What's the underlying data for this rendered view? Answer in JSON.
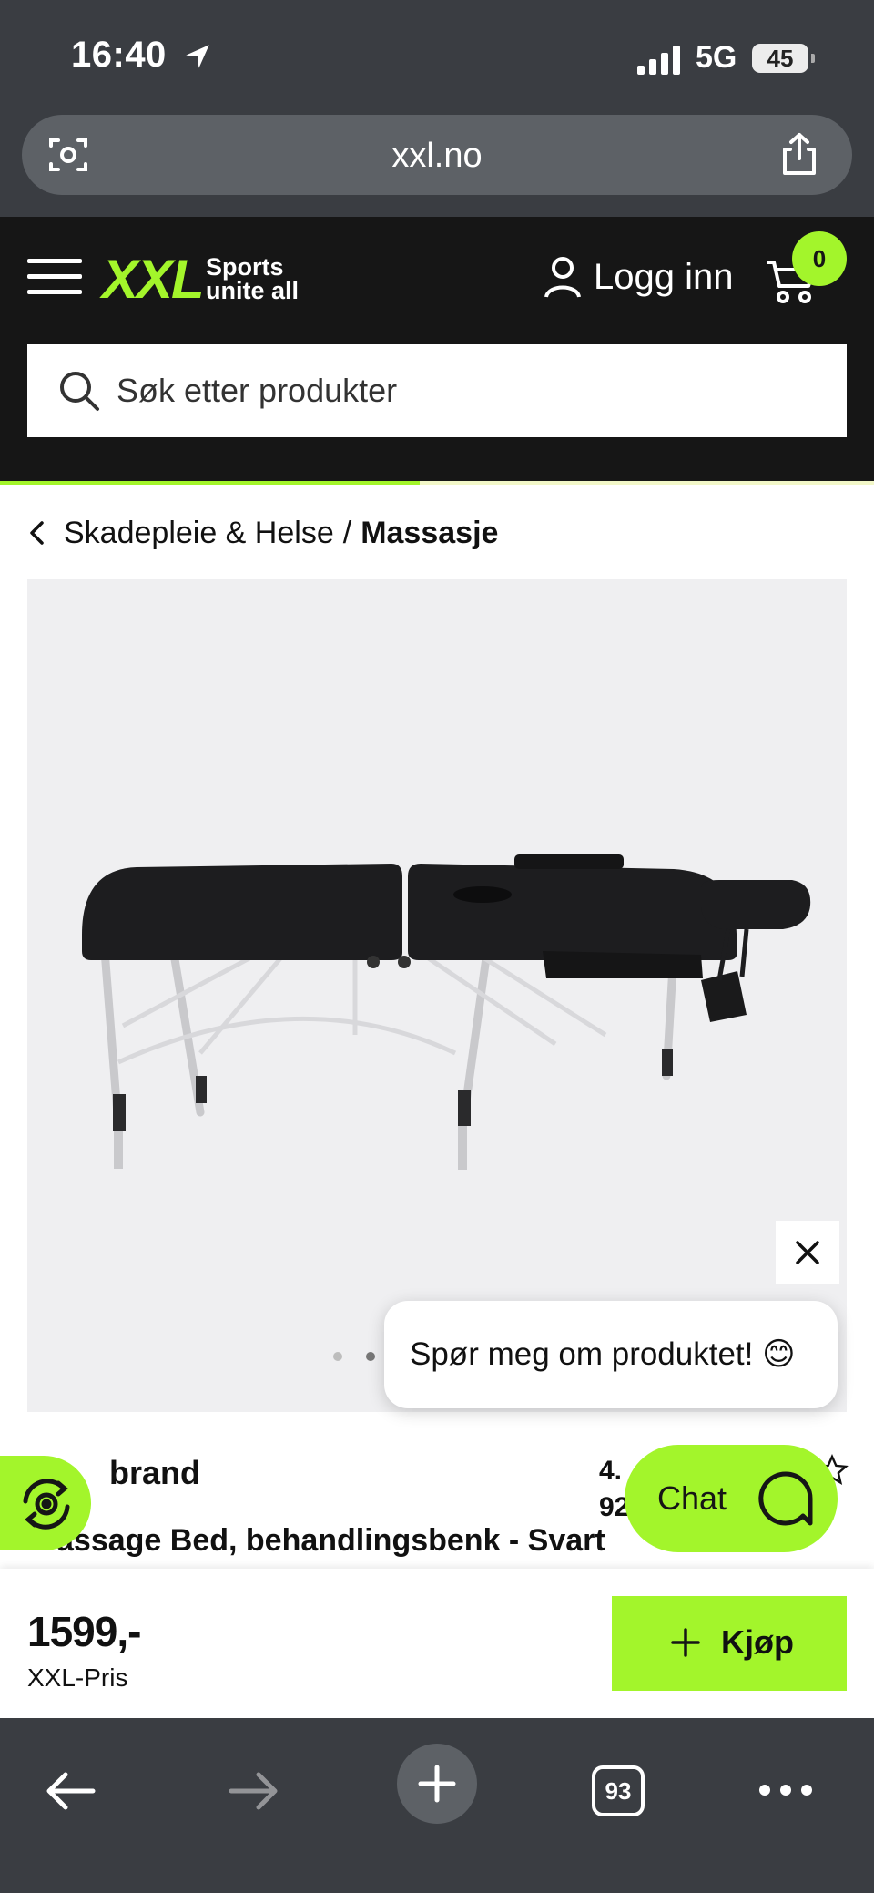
{
  "status_bar": {
    "time": "16:40",
    "network": "5G",
    "battery": "45"
  },
  "browser": {
    "url": "xxl.no",
    "tab_count": "93"
  },
  "header": {
    "logo_text": "XXL",
    "logo_tagline_line1": "Sports",
    "logo_tagline_line2": "unite all",
    "login_label": "Logg inn",
    "cart_count": "0",
    "search_placeholder": "Søk etter produkter",
    "accent_color": "#a3f52b",
    "page_load_progress": 0.48
  },
  "breadcrumb": {
    "parent": "Skadepleie & Helse",
    "separator": "/",
    "current": "Massasje"
  },
  "gallery": {
    "image_count": 2,
    "active_index": 1
  },
  "chat_prompt": {
    "text": "Spør meg om produktet! 😊"
  },
  "product": {
    "brand_visible": "brand",
    "rating_visible": "4.",
    "review_count_visible": "92",
    "title_visible": "assage Bed, behandlingsbenk - Svart"
  },
  "chat_button": {
    "label": "Chat"
  },
  "buy_bar": {
    "price": "1599,-",
    "price_label": "XXL-Pris",
    "buy_label": "Kjøp"
  },
  "icons": [
    "location-arrow-icon",
    "signal-icon",
    "camera-search-icon",
    "share-icon",
    "menu-icon",
    "user-icon",
    "cart-icon",
    "search-icon",
    "chevron-left-icon",
    "close-icon",
    "return-icon",
    "chat-icon",
    "plus-icon",
    "back-arrow-icon",
    "forward-arrow-icon",
    "new-tab-icon",
    "more-icon",
    "star-icon"
  ]
}
